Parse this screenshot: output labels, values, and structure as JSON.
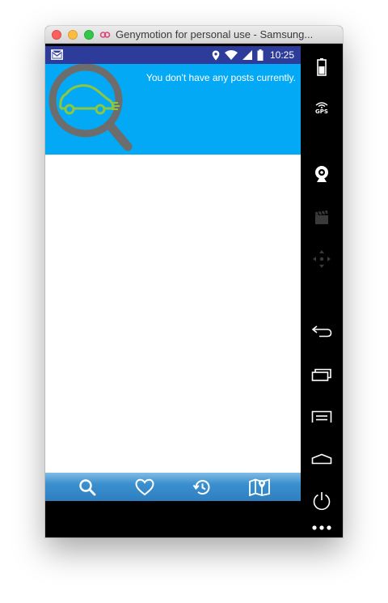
{
  "window": {
    "title": "Genymotion for personal use - Samsung..."
  },
  "statusbar": {
    "time": "10:25"
  },
  "banner": {
    "message": "You don't have any posts currently."
  },
  "colors": {
    "statusbar": "#2d3c9b",
    "banner": "#03a9f4",
    "logo_ring": "#6d6d6d",
    "logo_car": "#8dc63f",
    "bottom_nav": "#3a8fcf"
  },
  "bottom_nav": {
    "items": [
      {
        "icon": "search-icon"
      },
      {
        "icon": "heart-icon"
      },
      {
        "icon": "history-icon"
      },
      {
        "icon": "map-icon"
      }
    ]
  },
  "side_panel": {
    "items": [
      {
        "icon": "battery-icon"
      },
      {
        "icon": "gps-icon",
        "label": "GPS"
      },
      {
        "icon": "webcam-icon"
      },
      {
        "icon": "media-clapper-icon"
      },
      {
        "icon": "dpad-icon"
      },
      {
        "icon": "back-icon"
      },
      {
        "icon": "recent-apps-icon"
      },
      {
        "icon": "menu-icon"
      },
      {
        "icon": "home-icon"
      },
      {
        "icon": "power-icon"
      },
      {
        "icon": "more-icon"
      }
    ]
  }
}
